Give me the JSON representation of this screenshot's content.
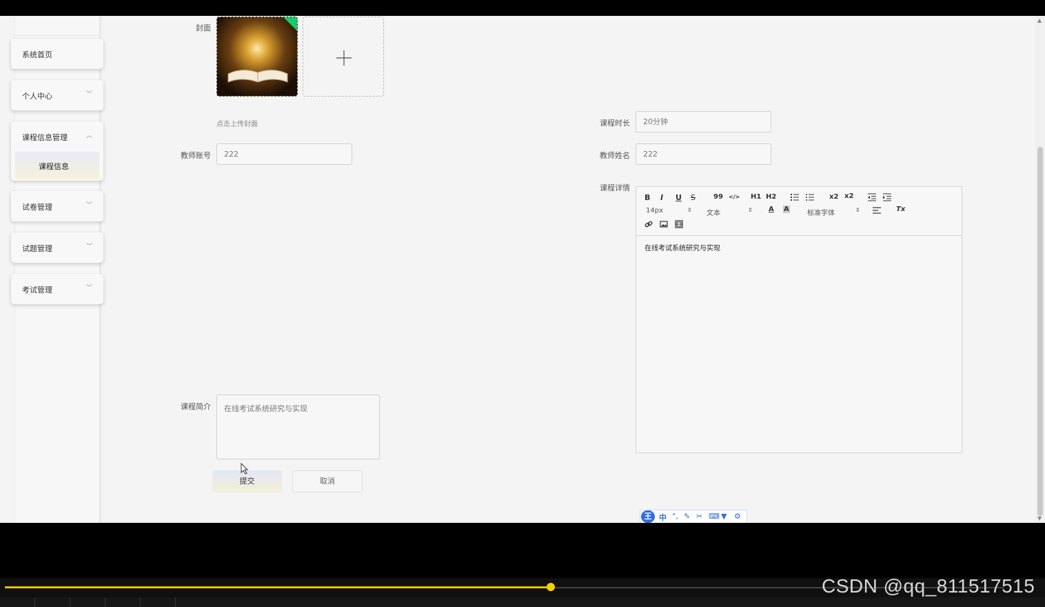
{
  "sidebar": {
    "items": [
      {
        "label": "系统首页",
        "chevron": ""
      },
      {
        "label": "个人中心",
        "chevron": "v"
      },
      {
        "label": "课程信息管理",
        "chevron": "^",
        "sub": "课程信息"
      },
      {
        "label": "试卷管理",
        "chevron": "v"
      },
      {
        "label": "试题管理",
        "chevron": "v"
      },
      {
        "label": "考试管理",
        "chevron": "v"
      }
    ]
  },
  "form": {
    "cover_label": "封面",
    "cover_hint": "点击上传封面",
    "duration_label": "课程时长",
    "duration_value": "20分钟",
    "teacher_account_label": "教师账号",
    "teacher_account_value": "222",
    "teacher_name_label": "教师姓名",
    "teacher_name_value": "222",
    "detail_label": "课程详情",
    "intro_label": "课程简介",
    "intro_value": "在线考试系统研究与实现",
    "submit_label": "提交",
    "cancel_label": "取消"
  },
  "editor": {
    "bold": "B",
    "italic": "I",
    "underline": "U",
    "strike": "S",
    "quote": "99",
    "code": "</>",
    "h1": "H1",
    "h2": "H2",
    "sub": "x2",
    "sup": "x2",
    "size": "14px",
    "format": "文本",
    "font": "标准字体",
    "clear": "Tx",
    "content": "在线考试系统研究与实现"
  },
  "ime": {
    "badge": "王",
    "lang": "中"
  },
  "player": {
    "progress": 0.546
  },
  "watermark": "CSDN @qq_811517515"
}
